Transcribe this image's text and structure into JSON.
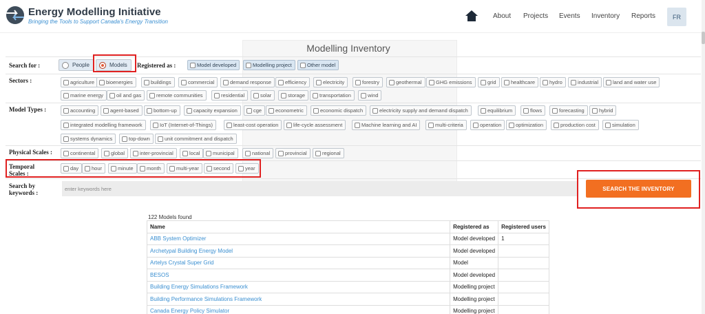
{
  "header": {
    "title": "Energy Modelling Initiative",
    "tagline": "Bringing the Tools to Support Canada's Energy Transition",
    "nav": [
      "About",
      "Projects",
      "Events",
      "Inventory",
      "Reports"
    ],
    "lang": "FR"
  },
  "page_title": "Modelling Inventory",
  "search_for": {
    "label": "Search for :",
    "options": [
      "People",
      "Models"
    ],
    "selected": "Models"
  },
  "registered_as": {
    "label": "Registered as :",
    "options": [
      "Model developed",
      "Modelling project",
      "Other model"
    ]
  },
  "sectors": {
    "label": "Sectors :",
    "options": [
      "agriculture",
      "bioenergies",
      "buildings",
      "commercial",
      "demand response",
      "efficiency",
      "electricity",
      "forestry",
      "geothermal",
      "GHG emissions",
      "grid",
      "healthcare",
      "hydro",
      "industrial",
      "land and water use",
      "marine energy",
      "oil and gas",
      "remote communities",
      "residential",
      "solar",
      "storage",
      "transportation",
      "wind"
    ]
  },
  "model_types": {
    "label": "Model Types :",
    "options": [
      "accounting",
      "agent-based",
      "bottom-up",
      "capacity expansion",
      "cge",
      "econometric",
      "economic dispatch",
      "electricity supply and demand dispatch",
      "equilibrium",
      "flows",
      "forecasting",
      "hybrid",
      "integrated modelling framework",
      "IoT (Internet-of-Things)",
      "least-cost operation",
      "life-cycle assessment",
      "Machine learning and AI",
      "multi-criteria",
      "operation",
      "optimization",
      "production cost",
      "simulation",
      "systems dynamics",
      "top-down",
      "unit commitment and dispatch"
    ]
  },
  "physical_scales": {
    "label": "Physical Scales :",
    "options": [
      "continental",
      "global",
      "inter-provincial",
      "local",
      "municipal",
      "national",
      "provincial",
      "regional"
    ]
  },
  "temporal_scales": {
    "label_1": "Temporal",
    "label_2": "Scales :",
    "options": [
      "day",
      "hour",
      "minute",
      "month",
      "multi-year",
      "second",
      "year"
    ]
  },
  "keywords": {
    "label_1": "Search by",
    "label_2": "keywords :",
    "placeholder": "enter keywords here"
  },
  "search_button": "SEARCH THE INVENTORY",
  "results": {
    "count_text": "122 Models found",
    "columns": [
      "Name",
      "Registered as",
      "Registered users"
    ],
    "rows": [
      [
        "ABB System Optimizer",
        "Model developed",
        "1"
      ],
      [
        "Archetypal Building Energy Model",
        "Model developed",
        ""
      ],
      [
        "Artelys Crystal Super Grid",
        "Model",
        ""
      ],
      [
        "BESOS",
        "Model developed",
        ""
      ],
      [
        "Building Energy Simulations Framework",
        "Modelling project",
        ""
      ],
      [
        "Building Performance Simulations Framework",
        "Modelling project",
        ""
      ],
      [
        "Canada Energy Policy Simulator",
        "Modelling project",
        ""
      ]
    ]
  },
  "colors": {
    "accent_orange": "#f26f21",
    "link_blue": "#3a8fd1",
    "highlight_red": "#e02020"
  }
}
